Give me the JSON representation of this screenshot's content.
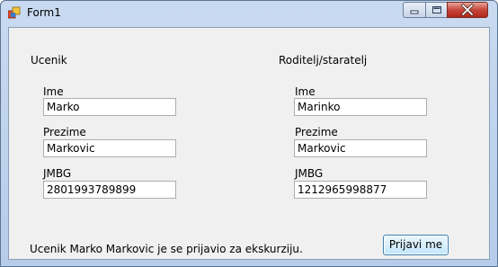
{
  "window": {
    "title": "Form1",
    "icon": "winforms-app-icon"
  },
  "controls": {
    "minimize_icon": "minimize-icon",
    "maximize_icon": "maximize-icon",
    "close_icon": "close-icon"
  },
  "student": {
    "header": "Ucenik",
    "first_name_label": "Ime",
    "first_name_value": "Marko",
    "last_name_label": "Prezime",
    "last_name_value": "Markovic",
    "jmbg_label": "JMBG",
    "jmbg_value": "2801993789899"
  },
  "parent": {
    "header": "Roditelj/staratelj",
    "first_name_label": "Ime",
    "first_name_value": "Marinko",
    "last_name_label": "Prezime",
    "last_name_value": "Markovic",
    "jmbg_label": "JMBG",
    "jmbg_value": "1212965998877"
  },
  "status": {
    "message": "Ucenik Marko Markovic je se prijavio za ekskurziju."
  },
  "actions": {
    "submit_label": "Prijavi me"
  }
}
